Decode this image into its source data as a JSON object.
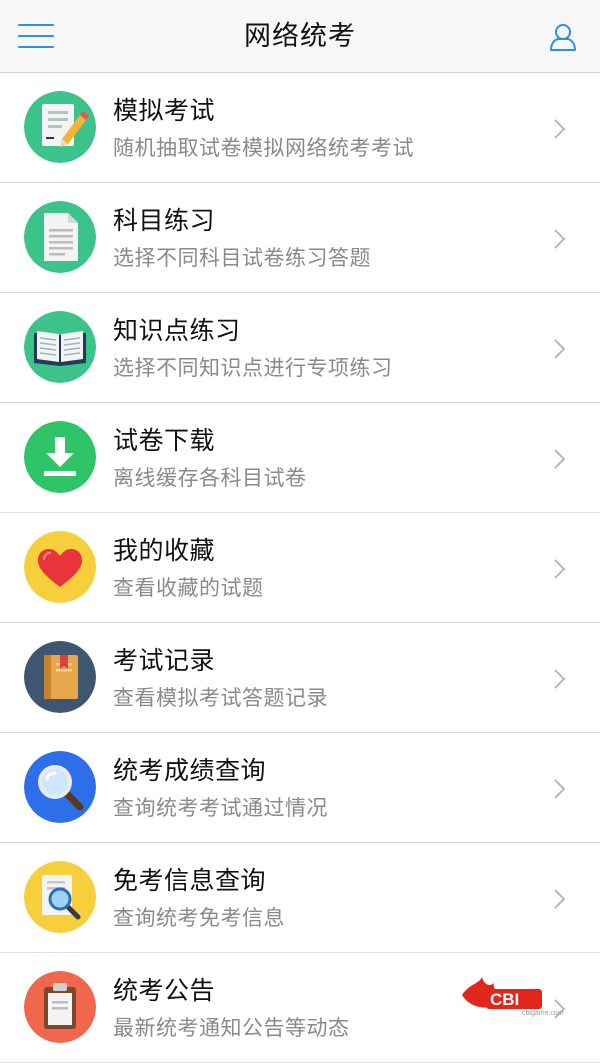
{
  "header": {
    "title": "网络统考",
    "menu_icon": "hamburger-menu-icon",
    "user_icon": "user-profile-icon"
  },
  "menu": {
    "items": [
      {
        "title": "模拟考试",
        "subtitle": "随机抽取试卷模拟网络统考考试",
        "icon": "exam-paper-pencil-icon",
        "color": "#3cc38a"
      },
      {
        "title": "科目练习",
        "subtitle": "选择不同科目试卷练习答题",
        "icon": "document-icon",
        "color": "#3cc38a"
      },
      {
        "title": "知识点练习",
        "subtitle": "选择不同知识点进行专项练习",
        "icon": "open-book-icon",
        "color": "#3cc38a"
      },
      {
        "title": "试卷下载",
        "subtitle": "离线缓存各科目试卷",
        "icon": "download-icon",
        "color": "#2fc467"
      },
      {
        "title": "我的收藏",
        "subtitle": "查看收藏的试题",
        "icon": "heart-icon",
        "color": "#f7cf3c"
      },
      {
        "title": "考试记录",
        "subtitle": "查看模拟考试答题记录",
        "icon": "notebook-icon",
        "color": "#3e566f"
      },
      {
        "title": "统考成绩查询",
        "subtitle": "查询统考考试通过情况",
        "icon": "magnifier-icon",
        "color": "#2d6fe8"
      },
      {
        "title": "免考信息查询",
        "subtitle": "查询统考免考信息",
        "icon": "document-search-icon",
        "color": "#f7cf3c"
      },
      {
        "title": "统考公告",
        "subtitle": "最新统考通知公告等动态",
        "icon": "clipboard-icon",
        "color": "#f0674e"
      }
    ]
  },
  "watermark": {
    "brand": "CBI",
    "site": "cbigame.com",
    "color": "#e1261c"
  }
}
